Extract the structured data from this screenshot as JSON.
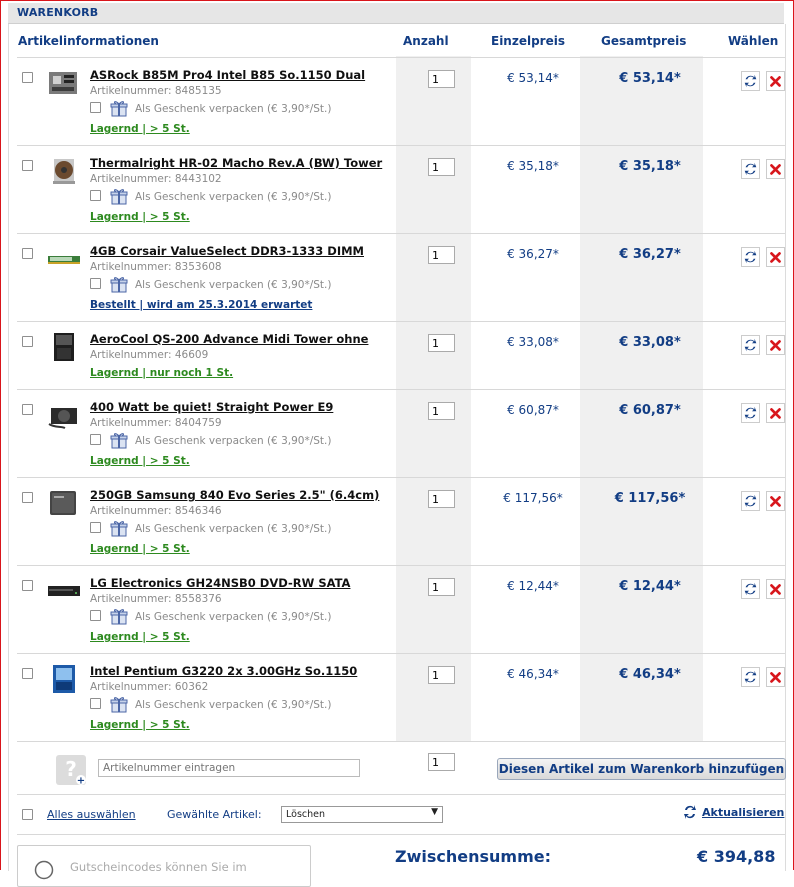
{
  "header": {
    "title": "WARENKORB"
  },
  "columns": {
    "info": "Artikelinformationen",
    "qty": "Anzahl",
    "unit": "Einzelpreis",
    "total": "Gesamtpreis",
    "select": "Wählen"
  },
  "common": {
    "artnr_prefix": "Artikelnummer: ",
    "gift_label": "Als Geschenk verpacken (€ 3,90*/St.)"
  },
  "items": [
    {
      "name": "ASRock B85M Pro4 Intel B85 So.1150 Dual",
      "artnr": "Artikelnummer: 8485135",
      "gift": true,
      "stock": "Lagernd | > 5 St.",
      "stock_color": "green",
      "qty": "1",
      "unit": "€ 53,14*",
      "total": "€ 53,14*",
      "thumb": "motherboard"
    },
    {
      "name": "Thermalright HR-02 Macho Rev.A (BW) Tower",
      "artnr": "Artikelnummer: 8443102",
      "gift": true,
      "stock": "Lagernd | > 5 St.",
      "stock_color": "green",
      "qty": "1",
      "unit": "€ 35,18*",
      "total": "€ 35,18*",
      "thumb": "cooler"
    },
    {
      "name": "4GB Corsair ValueSelect DDR3-1333 DIMM",
      "artnr": "Artikelnummer: 8353608",
      "gift": true,
      "stock": "Bestellt | wird am 25.3.2014 erwartet",
      "stock_color": "blue",
      "qty": "1",
      "unit": "€ 36,27*",
      "total": "€ 36,27*",
      "thumb": "ram"
    },
    {
      "name": "AeroCool QS-200 Advance Midi Tower ohne",
      "artnr": "Artikelnummer: 46609",
      "gift": false,
      "stock": "Lagernd | nur noch 1 St.",
      "stock_color": "green",
      "qty": "1",
      "unit": "€ 33,08*",
      "total": "€ 33,08*",
      "thumb": "case"
    },
    {
      "name": "400 Watt be quiet! Straight Power E9",
      "artnr": "Artikelnummer: 8404759",
      "gift": true,
      "stock": "Lagernd | > 5 St.",
      "stock_color": "green",
      "qty": "1",
      "unit": "€ 60,87*",
      "total": "€ 60,87*",
      "thumb": "psu"
    },
    {
      "name": "250GB Samsung 840 Evo Series 2.5\" (6.4cm)",
      "artnr": "Artikelnummer: 8546346",
      "gift": true,
      "stock": "Lagernd | > 5 St.",
      "stock_color": "green",
      "qty": "1",
      "unit": "€ 117,56*",
      "total": "€ 117,56*",
      "thumb": "ssd"
    },
    {
      "name": "LG Electronics GH24NSB0 DVD-RW SATA",
      "artnr": "Artikelnummer: 8558376",
      "gift": true,
      "stock": "Lagernd | > 5 St.",
      "stock_color": "green",
      "qty": "1",
      "unit": "€ 12,44*",
      "total": "€ 12,44*",
      "thumb": "dvd"
    },
    {
      "name": "Intel Pentium G3220 2x 3.00GHz So.1150",
      "artnr": "Artikelnummer: 60362",
      "gift": true,
      "stock": "Lagernd | > 5 St.",
      "stock_color": "green",
      "qty": "1",
      "unit": "€ 46,34*",
      "total": "€ 46,34*",
      "thumb": "cpu"
    }
  ],
  "add_row": {
    "placeholder": "Artikelnummer eintragen",
    "qty": "1",
    "button": "Diesen Artikel zum Warenkorb hinzufügen"
  },
  "footer": {
    "select_all": "Alles auswählen",
    "chosen_label": "Gewählte Artikel:",
    "action_value": "Löschen",
    "update": "Aktualisieren"
  },
  "summary": {
    "voucher_hint": "Gutscheincodes können Sie im",
    "subtotal_label": "Zwischensumme:",
    "subtotal_value": "€ 394,88"
  },
  "colors": {
    "brand_blue": "#123d84",
    "stock_green": "#2d8a1f",
    "delete_red": "#d8161c",
    "frame_red": "#d9151b"
  }
}
